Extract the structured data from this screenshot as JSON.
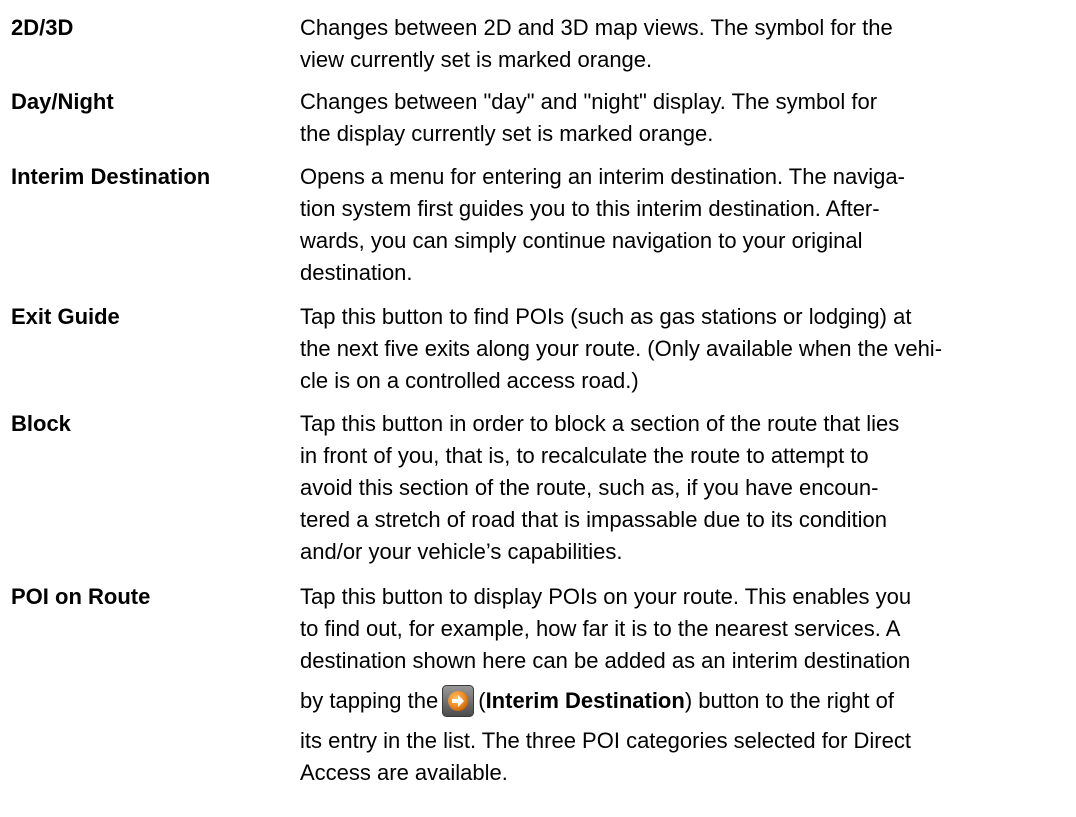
{
  "entries": [
    {
      "term": "2D/3D",
      "lines": [
        "Changes between 2D and 3D map views. The symbol for the",
        "view currently set is marked orange."
      ]
    },
    {
      "term": "Day/Night",
      "lines": [
        "Changes between \"day\" and \"night\" display. The symbol for",
        "the display currently set is marked orange."
      ]
    },
    {
      "term": "Interim Destination",
      "lines": [
        "Opens a menu for entering an interim destination. The naviga-",
        "tion system first guides you to this interim destination. After-",
        "wards, you can simply continue navigation to your original",
        "destination."
      ]
    },
    {
      "term": "Exit Guide",
      "lines": [
        "Tap this button to find POIs (such as gas stations or lodging) at",
        "the next five exits along your route. (Only available when the vehi-",
        "cle is on a controlled access road.)"
      ]
    },
    {
      "term": "Block",
      "lines": [
        "Tap this button in order to block a section of the route that lies",
        "in front of you, that is, to recalculate the route to attempt to",
        "avoid this section of the route, such as, if you have encoun-",
        "tered a stretch of road that is impassable due to its condition",
        "and/or your vehicle’s capabilities."
      ]
    },
    {
      "term": "POI on Route",
      "lines": [
        "Tap this button to display POIs on your route. This enables you",
        "to find out, for example, how far it is to the nearest services. A",
        "destination shown here can be added as an interim destination"
      ],
      "icon_line": {
        "before": "by tapping the",
        "icon": "interim-destination-arrow-icon",
        "paren_open": "(",
        "bold": "Interim Destination",
        "after": ") button to the right of"
      },
      "lines_after": [
        "its entry in the list. The three POI categories selected for Direct",
        "Access are available."
      ]
    }
  ],
  "colors": {
    "icon_orange": "#f28a1e",
    "icon_frame": "#6e6e6e"
  }
}
